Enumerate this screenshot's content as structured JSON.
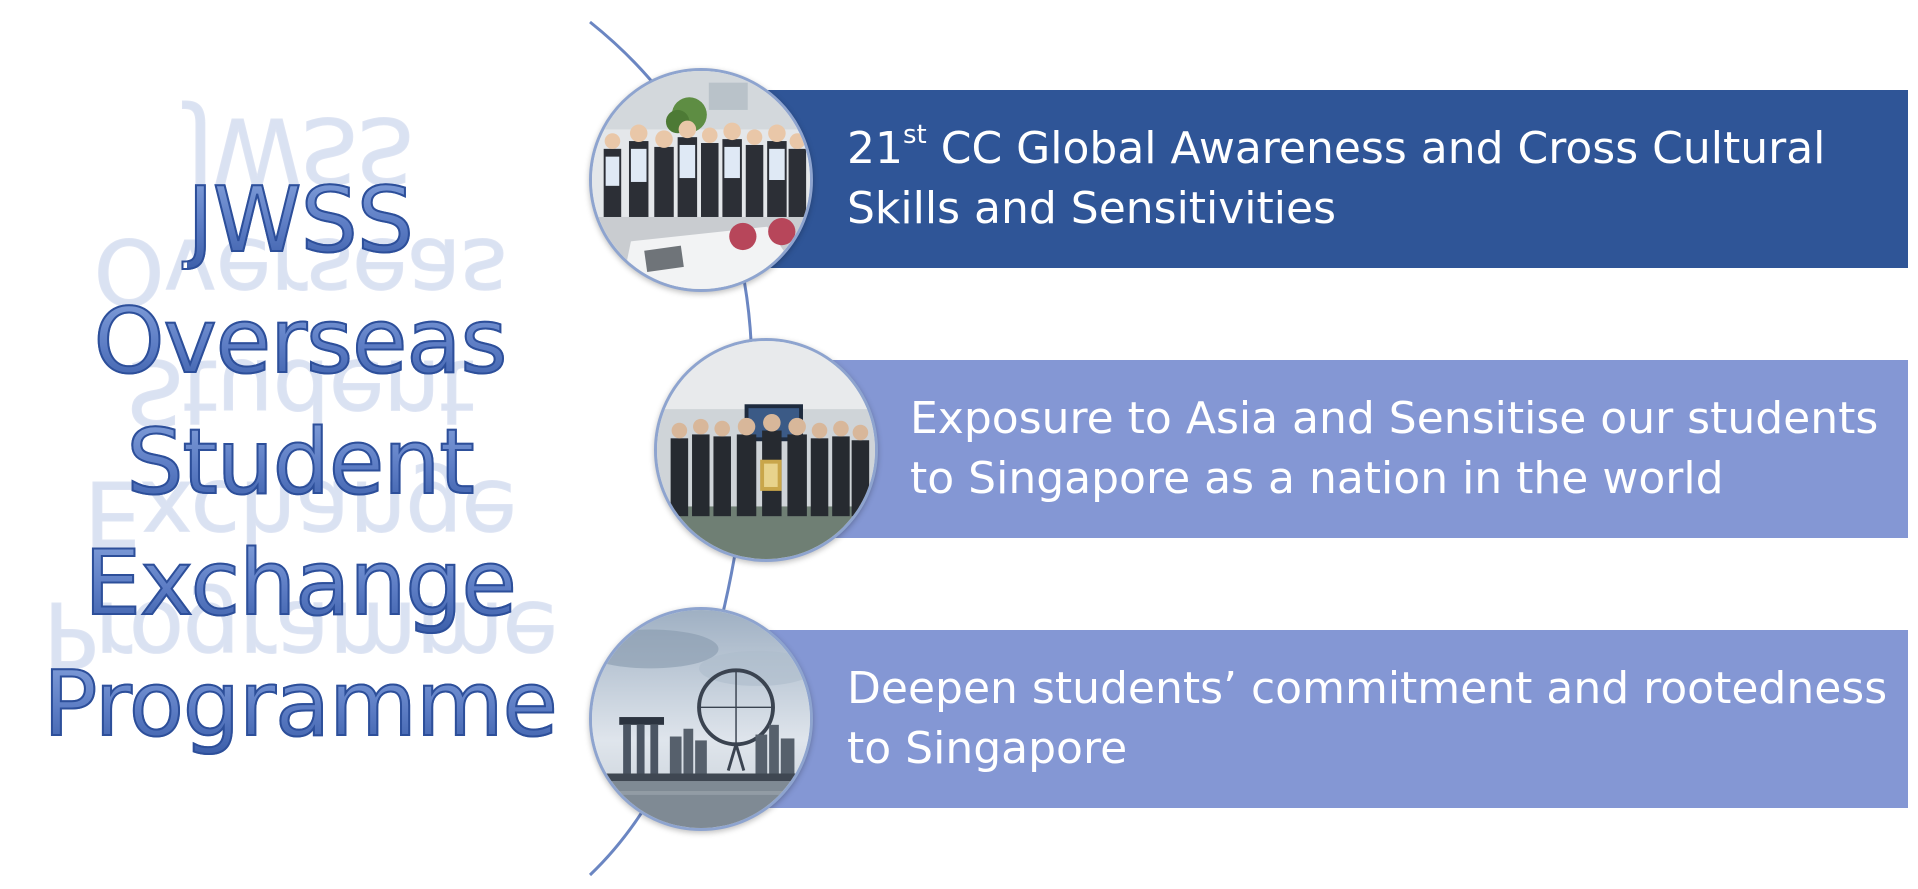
{
  "title": {
    "lines": [
      "JWSS",
      "Overseas",
      "Student",
      "Exchange",
      "Programme"
    ]
  },
  "items": [
    {
      "prefix": "21",
      "sup": "st",
      "text": " CC Global Awareness and Cross Cultural Skills and Sensitivities",
      "color": "#2f5597"
    },
    {
      "prefix": "",
      "sup": "",
      "text": "Exposure to Asia and Sensitise our students to Singapore as a nation in the world",
      "color": "#8497d4"
    },
    {
      "prefix": "",
      "sup": "",
      "text": "Deepen students’ commitment and rootedness to Singapore",
      "color": "#8497d4"
    }
  ],
  "colors": {
    "title_fill": "#5c7cc4",
    "title_outline": "#2d4f9a",
    "curve": "#6b86c2"
  },
  "icons": [
    "group-photo-meeting-room",
    "group-photo-plaque",
    "singapore-skyline-photo"
  ]
}
